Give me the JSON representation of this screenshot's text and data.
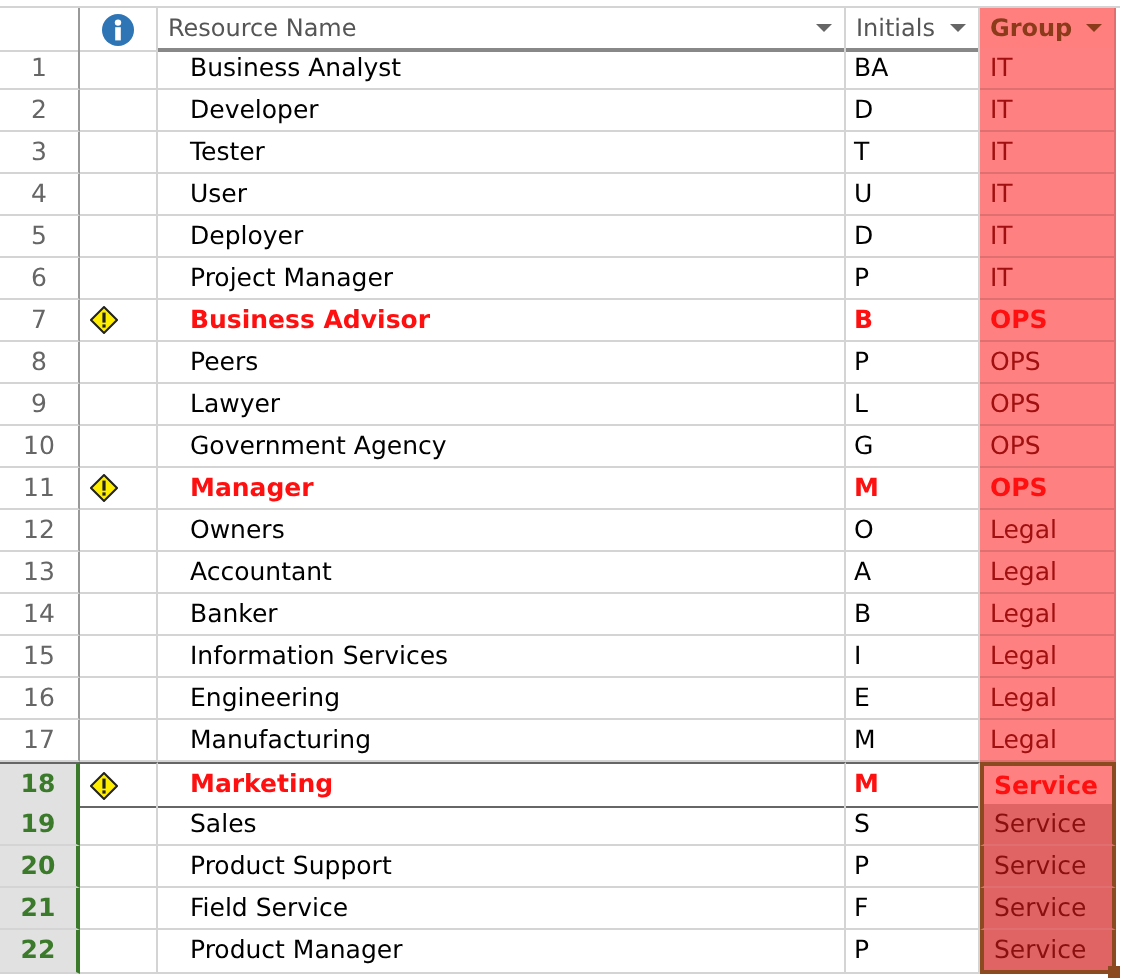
{
  "table": {
    "columns": [
      {
        "kind": "number"
      },
      {
        "kind": "info"
      },
      {
        "kind": "name",
        "label": "Resource Name",
        "filter": true,
        "highlighted": false
      },
      {
        "kind": "initials",
        "label": "Initials",
        "filter": true,
        "highlighted": false
      },
      {
        "kind": "group",
        "label": "Group",
        "filter": true,
        "highlighted": true
      }
    ],
    "rows": [
      {
        "number": "1",
        "name": "Business Analyst",
        "initials": "BA",
        "group": "IT",
        "flagged": false,
        "selected": false,
        "active": false
      },
      {
        "number": "2",
        "name": "Developer",
        "initials": "D",
        "group": "IT",
        "flagged": false,
        "selected": false,
        "active": false
      },
      {
        "number": "3",
        "name": "Tester",
        "initials": "T",
        "group": "IT",
        "flagged": false,
        "selected": false,
        "active": false
      },
      {
        "number": "4",
        "name": "User",
        "initials": "U",
        "group": "IT",
        "flagged": false,
        "selected": false,
        "active": false
      },
      {
        "number": "5",
        "name": "Deployer",
        "initials": "D",
        "group": "IT",
        "flagged": false,
        "selected": false,
        "active": false
      },
      {
        "number": "6",
        "name": "Project Manager",
        "initials": "P",
        "group": "IT",
        "flagged": false,
        "selected": false,
        "active": false
      },
      {
        "number": "7",
        "name": "Business Advisor",
        "initials": "B",
        "group": "OPS",
        "flagged": true,
        "selected": false,
        "active": false
      },
      {
        "number": "8",
        "name": "Peers",
        "initials": "P",
        "group": "OPS",
        "flagged": false,
        "selected": false,
        "active": false
      },
      {
        "number": "9",
        "name": "Lawyer",
        "initials": "L",
        "group": "OPS",
        "flagged": false,
        "selected": false,
        "active": false
      },
      {
        "number": "10",
        "name": "Government Agency",
        "initials": "G",
        "group": "OPS",
        "flagged": false,
        "selected": false,
        "active": false
      },
      {
        "number": "11",
        "name": "Manager",
        "initials": "M",
        "group": "OPS",
        "flagged": true,
        "selected": false,
        "active": false
      },
      {
        "number": "12",
        "name": "Owners",
        "initials": "O",
        "group": "Legal",
        "flagged": false,
        "selected": false,
        "active": false
      },
      {
        "number": "13",
        "name": "Accountant",
        "initials": "A",
        "group": "Legal",
        "flagged": false,
        "selected": false,
        "active": false
      },
      {
        "number": "14",
        "name": "Banker",
        "initials": "B",
        "group": "Legal",
        "flagged": false,
        "selected": false,
        "active": false
      },
      {
        "number": "15",
        "name": "Information Services",
        "initials": "I",
        "group": "Legal",
        "flagged": false,
        "selected": false,
        "active": false
      },
      {
        "number": "16",
        "name": "Engineering",
        "initials": "E",
        "group": "Legal",
        "flagged": false,
        "selected": false,
        "active": false
      },
      {
        "number": "17",
        "name": "Manufacturing",
        "initials": "M",
        "group": "Legal",
        "flagged": false,
        "selected": false,
        "active": false
      },
      {
        "number": "18",
        "name": "Marketing",
        "initials": "M",
        "group": "Service",
        "flagged": true,
        "selected": true,
        "active": true
      },
      {
        "number": "19",
        "name": "Sales",
        "initials": "S",
        "group": "Service",
        "flagged": false,
        "selected": true,
        "active": false
      },
      {
        "number": "20",
        "name": "Product Support",
        "initials": "P",
        "group": "Service",
        "flagged": false,
        "selected": true,
        "active": false
      },
      {
        "number": "21",
        "name": "Field Service",
        "initials": "F",
        "group": "Service",
        "flagged": false,
        "selected": true,
        "active": false
      },
      {
        "number": "22",
        "name": "Product Manager",
        "initials": "P",
        "group": "Service",
        "flagged": false,
        "selected": true,
        "active": false
      }
    ]
  }
}
